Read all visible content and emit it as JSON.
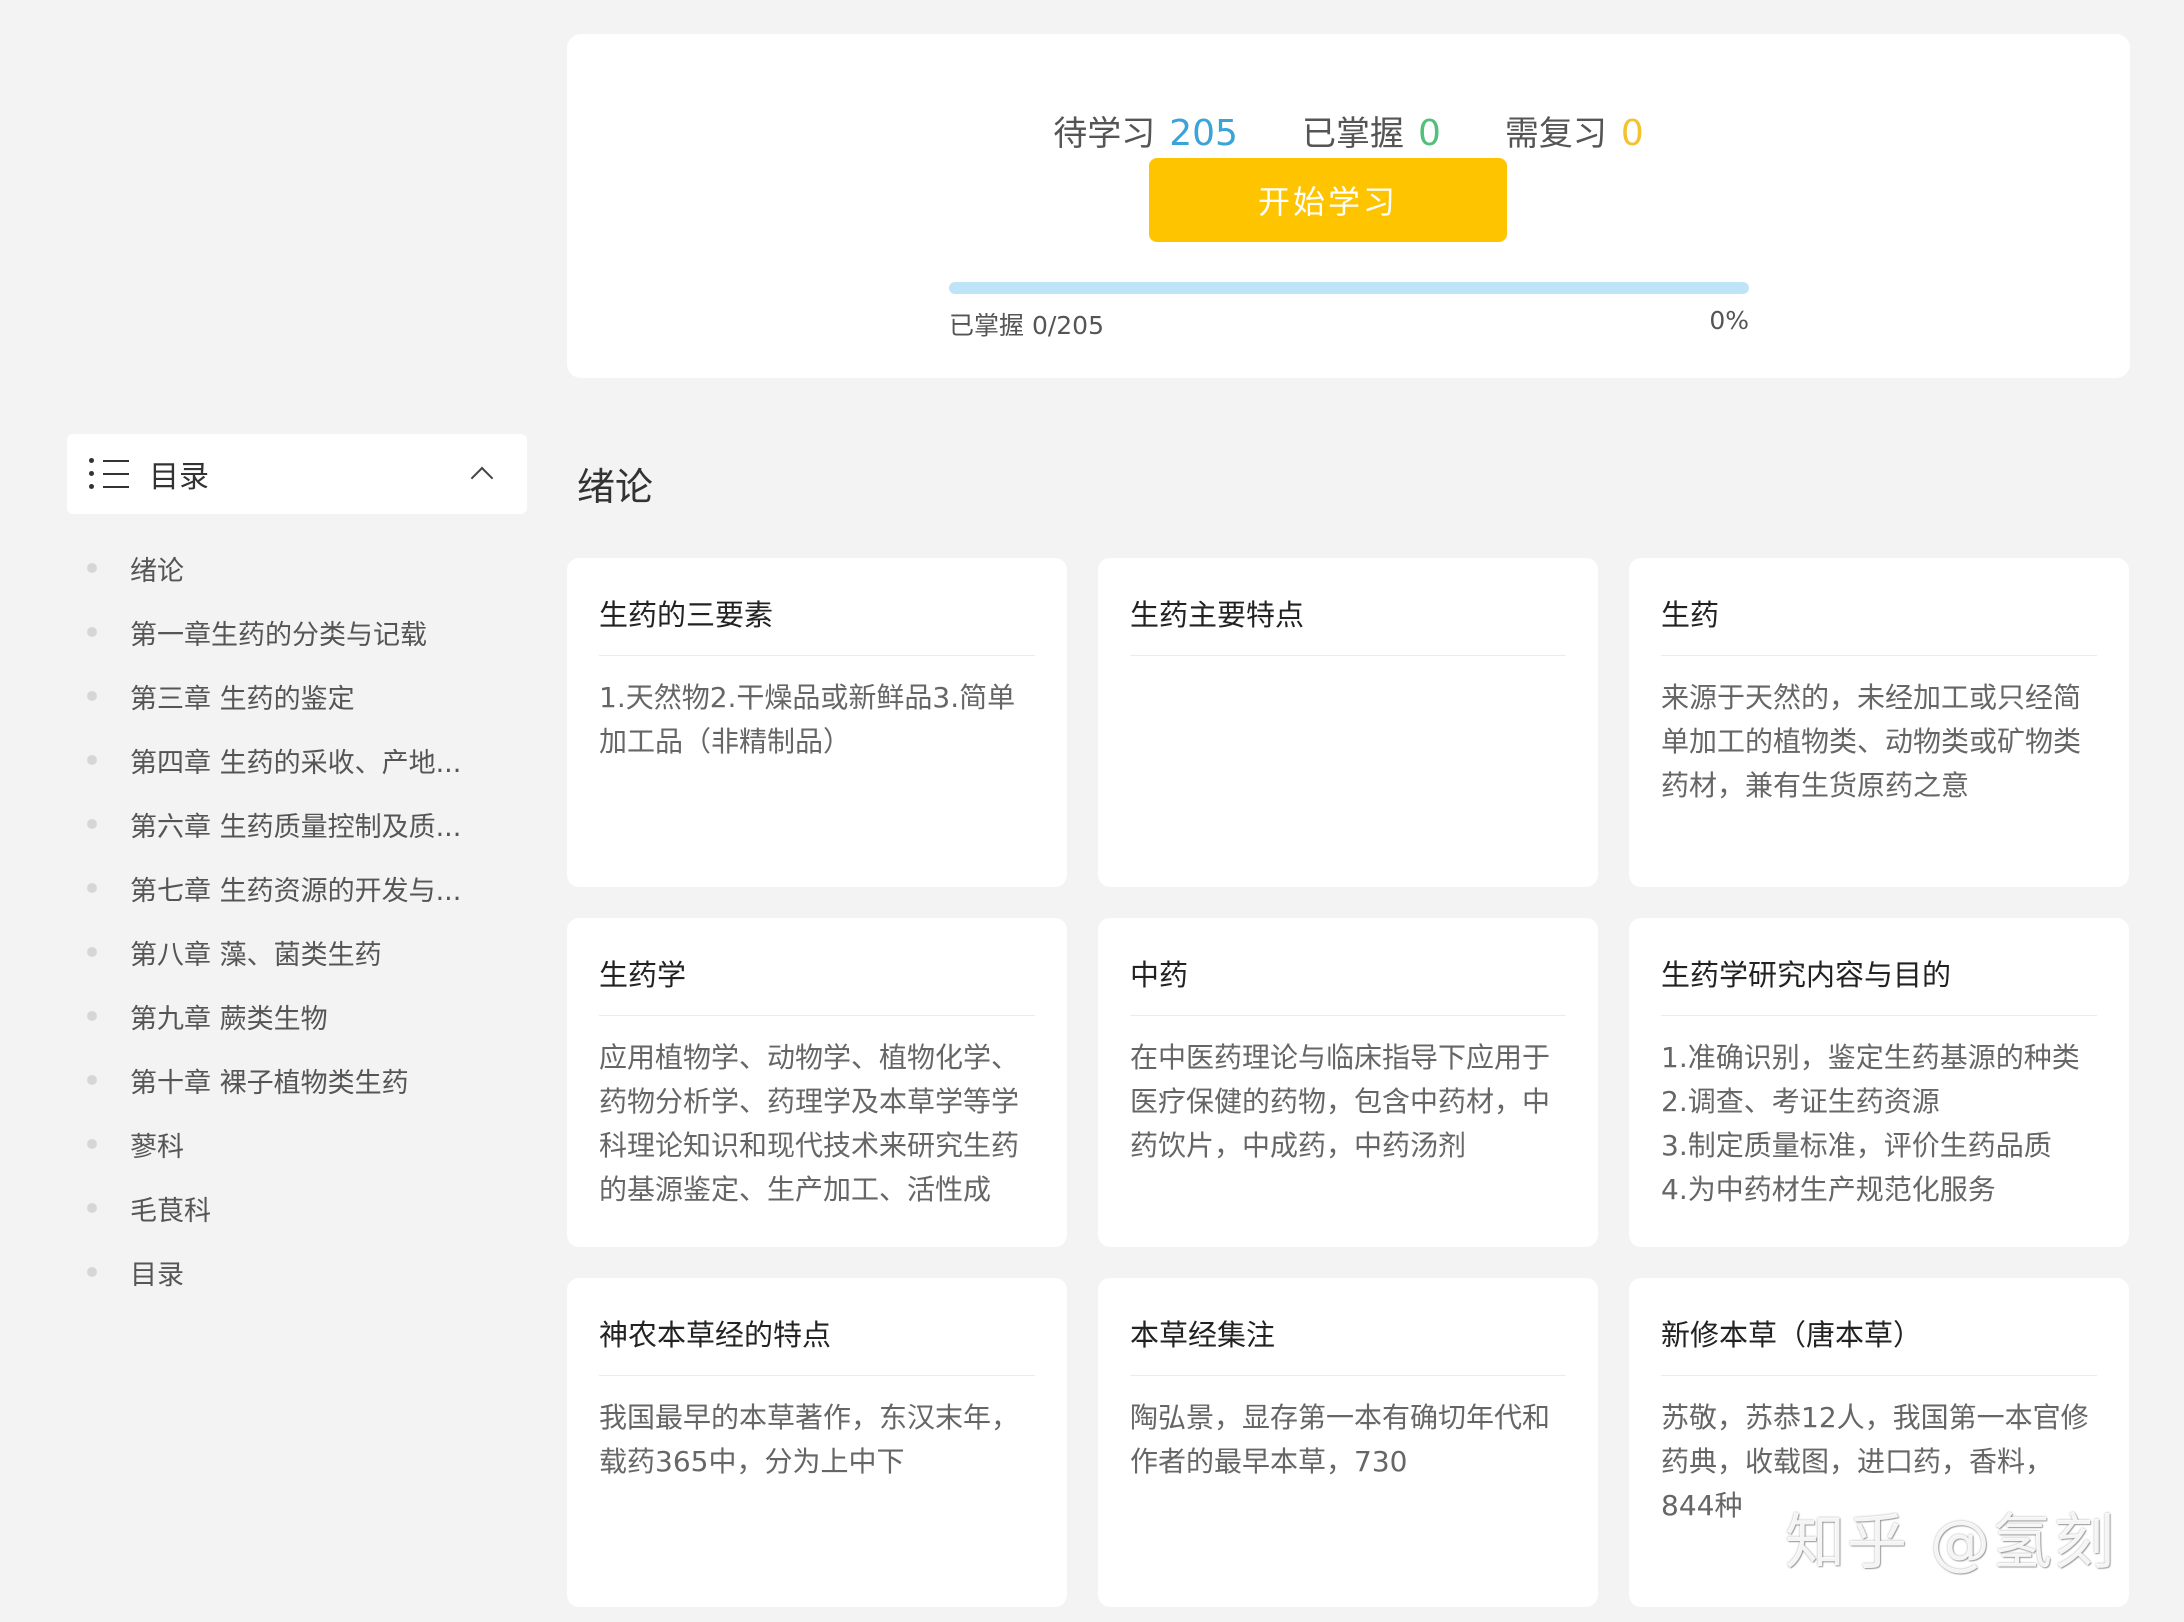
{
  "stats": {
    "pending_label": "待学习",
    "pending_value": "205",
    "mastered_label": "已掌握",
    "mastered_value": "0",
    "review_label": "需复习",
    "review_value": "0"
  },
  "start_button": "开始学习",
  "progress": {
    "left_label": "已掌握 0/205",
    "right_label": "0%",
    "fraction": 0
  },
  "colors": {
    "pending": "#3aa3d8",
    "mastered": "#52c07a",
    "review": "#f2c230",
    "accent_button": "#ffc400"
  },
  "toc": {
    "icon": "list-icon",
    "title": "目录",
    "collapse_icon": "chevron-up-icon",
    "items": [
      {
        "label": "绪论"
      },
      {
        "label": "第一章生药的分类与记载"
      },
      {
        "label": "第三章 生药的鉴定"
      },
      {
        "label": "第四章 生药的采收、产地..."
      },
      {
        "label": "第六章 生药质量控制及质..."
      },
      {
        "label": "第七章 生药资源的开发与..."
      },
      {
        "label": "第八章 藻、菌类生药"
      },
      {
        "label": "第九章 蕨类生物"
      },
      {
        "label": "第十章 裸子植物类生药"
      },
      {
        "label": "蓼科"
      },
      {
        "label": "毛茛科"
      },
      {
        "label": "目录"
      }
    ]
  },
  "section": {
    "title": "绪论",
    "cards": [
      {
        "title": "生药的三要素",
        "body": "1.天然物2.干燥品或新鲜品3.简单\n加工品（非精制品）"
      },
      {
        "title": "生药主要特点",
        "body": ""
      },
      {
        "title": "生药",
        "body": "来源于天然的，未经加工或只经简\n单加工的植物类、动物类或矿物类\n药材，兼有生货原药之意"
      },
      {
        "title": "生药学",
        "body": "应用植物学、动物学、植物化学、\n药物分析学、药理学及本草学等学\n科理论知识和现代技术来研究生药\n的基源鉴定、生产加工、活性成"
      },
      {
        "title": "中药",
        "body": "在中医药理论与临床指导下应用于\n医疗保健的药物，包含中药材，中\n药饮片，中成药，中药汤剂"
      },
      {
        "title": "生药学研究内容与目的",
        "body": "1.准确识别，鉴定生药基源的种类\n2.调查、考证生药资源\n3.制定质量标准，评价生药品质\n4.为中药材生产规范化服务"
      },
      {
        "title": "神农本草经的特点",
        "body": "我国最早的本草著作，东汉末年，\n载药365中，分为上中下"
      },
      {
        "title": "本草经集注",
        "body": "陶弘景，显存第一本有确切年代和\n作者的最早本草，730"
      },
      {
        "title": "新修本草（唐本草）",
        "body": "苏敬，苏恭12人，我国第一本官修\n药典，收载图，进口药，香料，\n844种"
      }
    ]
  },
  "watermark": "知乎 @氢刻"
}
